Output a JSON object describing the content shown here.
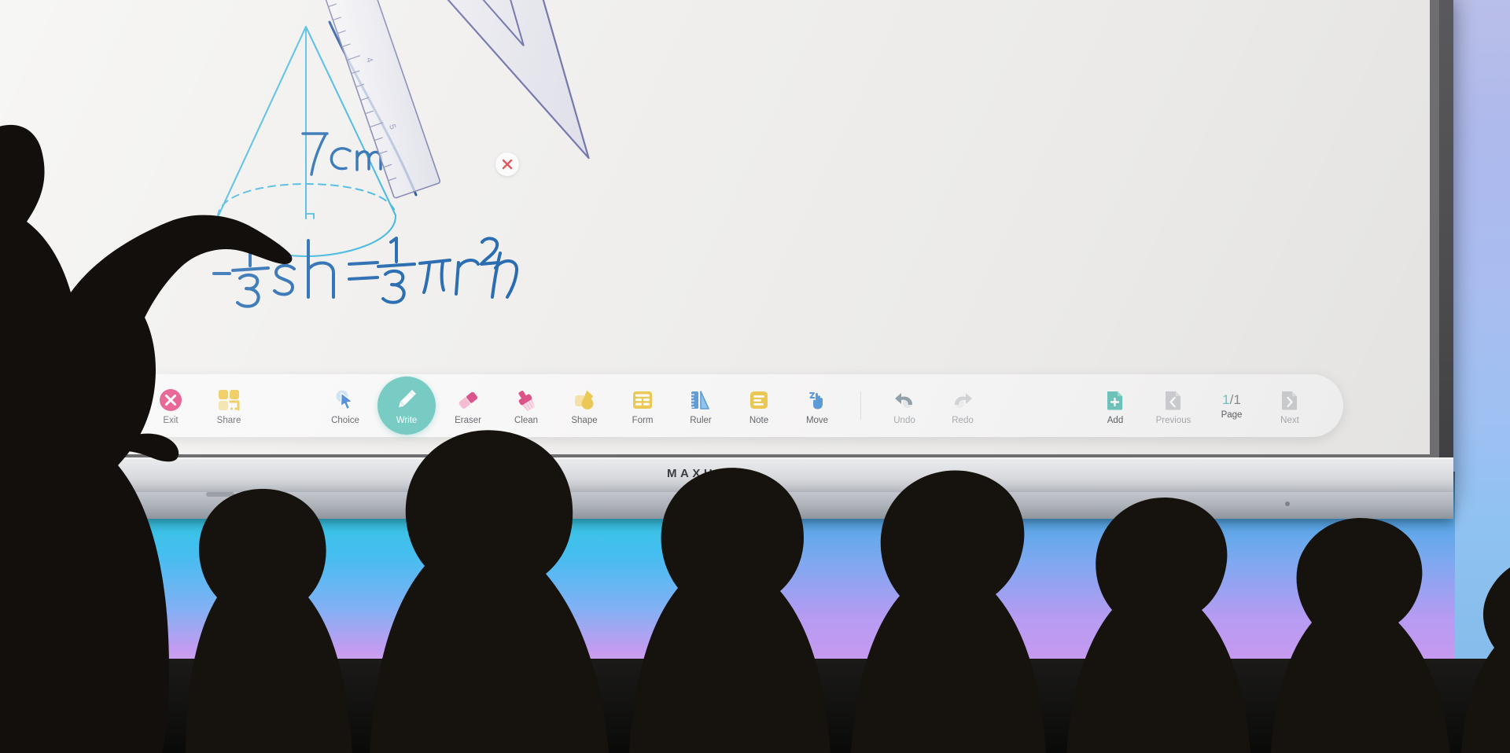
{
  "device": {
    "brand": "MAXHUB",
    "type": "interactive-flat-panel"
  },
  "whiteboard": {
    "annotations": {
      "height_label": "7cm",
      "formula": "= 1/3 sh = 1/3 πr²h",
      "formula_parts": {
        "eq1": "=",
        "frac1_num": "1",
        "frac1_den": "3",
        "term1": "sh",
        "eq2": "=",
        "frac2_num": "1",
        "frac2_den": "3",
        "term2": "πr²h"
      }
    },
    "objects": [
      {
        "name": "cone-drawing",
        "color": "#3ab3dd"
      },
      {
        "name": "ruler-tool",
        "color": "#6b6fa8"
      },
      {
        "name": "set-square-tool",
        "color": "#6b6fa8"
      },
      {
        "name": "ink-stroke",
        "color": "#1b63ad"
      }
    ],
    "close_marker": "×"
  },
  "toolbar": {
    "list_icon": "list-icon",
    "items": [
      {
        "id": "exit",
        "label": "Exit",
        "icon": "close-circle-icon",
        "state": "normal",
        "color": "#e2457f"
      },
      {
        "id": "share",
        "label": "Share",
        "icon": "qr-share-icon",
        "state": "normal",
        "color": "#edc84f"
      },
      {
        "id": "choice",
        "label": "Choice",
        "icon": "cursor-arrow-icon",
        "state": "normal",
        "color": "#4a87d6"
      },
      {
        "id": "write",
        "label": "Write",
        "icon": "pen-icon",
        "state": "active",
        "color": "#6fc8bf"
      },
      {
        "id": "eraser",
        "label": "Eraser",
        "icon": "eraser-icon",
        "state": "normal",
        "color": "#d94a83"
      },
      {
        "id": "clean",
        "label": "Clean",
        "icon": "brush-icon",
        "state": "normal",
        "color": "#d94a83"
      },
      {
        "id": "shape",
        "label": "Shape",
        "icon": "shapes-icon",
        "state": "normal",
        "color": "#edc84f"
      },
      {
        "id": "form",
        "label": "Form",
        "icon": "table-icon",
        "state": "normal",
        "color": "#edc84f"
      },
      {
        "id": "ruler",
        "label": "Ruler",
        "icon": "ruler-icon",
        "state": "normal",
        "color": "#5b9bd9"
      },
      {
        "id": "note",
        "label": "Note",
        "icon": "note-icon",
        "state": "normal",
        "color": "#edc84f"
      },
      {
        "id": "move",
        "label": "Move",
        "icon": "hand-move-icon",
        "state": "normal",
        "color": "#5b9bd9"
      },
      {
        "id": "undo",
        "label": "Undo",
        "icon": "undo-arrow-icon",
        "state": "enabled",
        "color": "#93a3ac"
      },
      {
        "id": "redo",
        "label": "Redo",
        "icon": "redo-arrow-icon",
        "state": "disabled",
        "color": "#d4d6d8"
      },
      {
        "id": "add",
        "label": "Add",
        "icon": "add-page-icon",
        "state": "normal",
        "color": "#6fc8bf"
      },
      {
        "id": "previous",
        "label": "Previous",
        "icon": "prev-page-icon",
        "state": "disabled",
        "color": "#cfd1d4"
      },
      {
        "id": "next",
        "label": "Next",
        "icon": "next-page-icon",
        "state": "disabled",
        "color": "#cfd1d4"
      }
    ],
    "pager": {
      "label": "Page",
      "value": "1/1",
      "current": "1",
      "separator": "/",
      "total": "1"
    }
  },
  "scene": {
    "description": "classroom-silhouettes",
    "teacher_side": "left",
    "student_count": 6
  },
  "colors": {
    "accent_teal": "#6fc8bf",
    "accent_pink": "#e2457f",
    "accent_yellow": "#edc84f",
    "accent_blue": "#5b9bd9",
    "board_bg": "#f0efed",
    "ink_cyan": "#3ab3dd",
    "ink_blue": "#1b63ad"
  }
}
